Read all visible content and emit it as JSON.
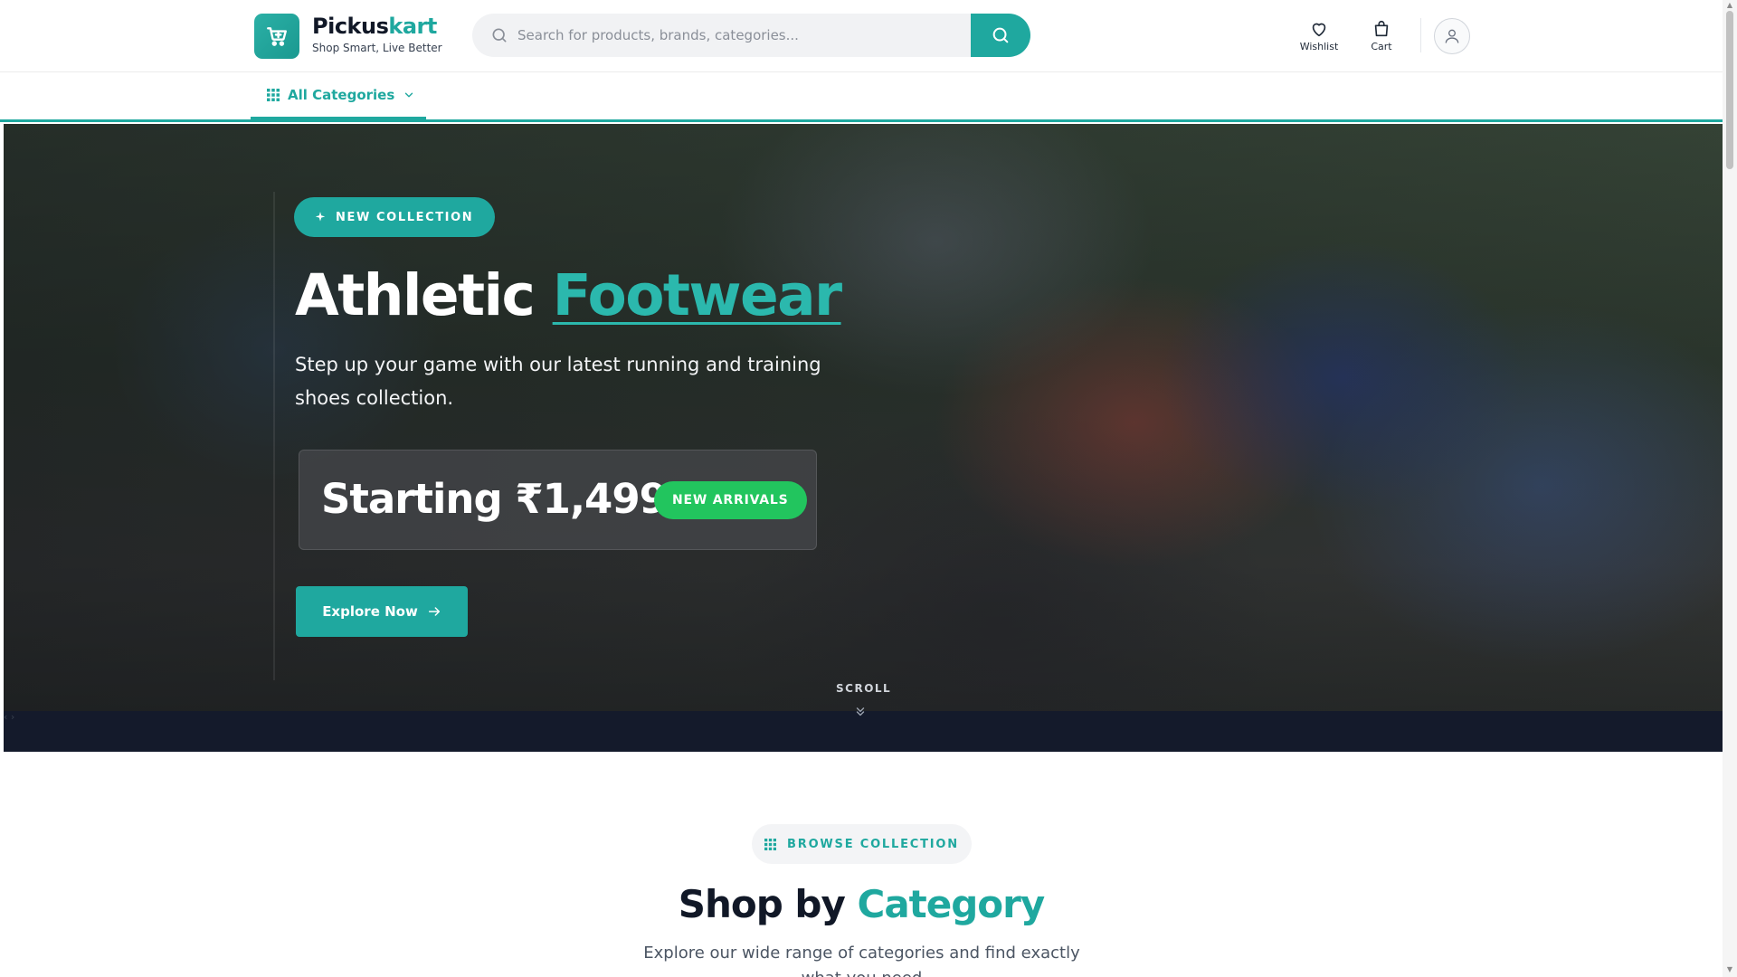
{
  "brand": {
    "name_main": "Pickus",
    "name_accent": "kart",
    "tagline": "Shop Smart, Live Better"
  },
  "search": {
    "placeholder": "Search for products, brands, categories..."
  },
  "header": {
    "wishlist_label": "Wishlist",
    "cart_label": "Cart"
  },
  "nav": {
    "all_categories_label": "All Categories"
  },
  "hero": {
    "badge": "NEW COLLECTION",
    "title_main": "Athletic ",
    "title_accent": "Footwear",
    "subtitle": "Step up your game with our latest running and training shoes collection.",
    "price_text": "Starting ₹1,499",
    "price_badge": "NEW ARRIVALS",
    "cta_label": "Explore Now",
    "scroll_label": "SCROLL"
  },
  "browse": {
    "pill_label": "BROWSE COLLECTION",
    "title_main": "Shop by ",
    "title_accent": "Category",
    "subtitle": "Explore our wide range of categories and find exactly what you need"
  },
  "colors": {
    "accent": "#1fa89f",
    "success": "#22c55e",
    "dark": "#111827"
  },
  "icons": {
    "logo": "shopping-cart-icon",
    "search": "search-icon",
    "wishlist": "heart-icon",
    "cart": "shopping-bag-icon",
    "account": "user-icon",
    "categories": "grid-icon",
    "sparkle": "sparkle-icon",
    "arrow": "arrow-right-icon"
  }
}
